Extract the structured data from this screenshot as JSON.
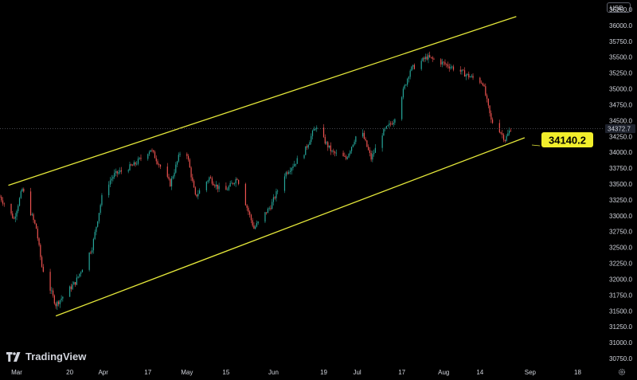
{
  "currency_label": "USD",
  "brand": {
    "name": "TradingView",
    "icon": "tradingview-logo-icon"
  },
  "settings_icon": "gear-icon",
  "colors": {
    "up": "#26a69a",
    "down": "#ef5350",
    "channel": "#e5e83a",
    "label_bg": "#f1ee2b",
    "axis_text": "#d1d4dc"
  },
  "chart_data": {
    "type": "candlestick",
    "y_axis": {
      "range": [
        30650,
        36400
      ],
      "ticks": [
        "36250.0",
        "36000.0",
        "35750.0",
        "35500.0",
        "35250.0",
        "35000.0",
        "34750.0",
        "34500.0",
        "34250.0",
        "34000.0",
        "33750.0",
        "33500.0",
        "33250.0",
        "33000.0",
        "32750.0",
        "32500.0",
        "32250.0",
        "32000.0",
        "31750.0",
        "31500.0",
        "31250.0",
        "31000.0",
        "30750.0"
      ]
    },
    "x_axis": {
      "ticks": [
        {
          "label": "Mar",
          "date": "2023-03-01"
        },
        {
          "label": "20",
          "date": "2023-03-20"
        },
        {
          "label": "Apr",
          "date": "2023-04-01"
        },
        {
          "label": "17",
          "date": "2023-04-17"
        },
        {
          "label": "May",
          "date": "2023-05-01"
        },
        {
          "label": "15",
          "date": "2023-05-15"
        },
        {
          "label": "Jun",
          "date": "2023-06-01"
        },
        {
          "label": "19",
          "date": "2023-06-19"
        },
        {
          "label": "Jul",
          "date": "2023-07-01"
        },
        {
          "label": "17",
          "date": "2023-07-17"
        },
        {
          "label": "Aug",
          "date": "2023-08-01"
        },
        {
          "label": "14",
          "date": "2023-08-14"
        },
        {
          "label": "Sep",
          "date": "2023-09-01"
        },
        {
          "label": "18",
          "date": "2023-09-18"
        }
      ],
      "range": [
        "2023-02-23",
        "2023-09-27"
      ]
    },
    "channel_lines": [
      {
        "name": "upper",
        "start": {
          "date": "2023-02-26",
          "value": 33480
        },
        "end": {
          "date": "2023-08-27",
          "value": 36140
        }
      },
      {
        "name": "lower",
        "start": {
          "date": "2023-03-15",
          "value": 31420
        },
        "end": {
          "date": "2023-08-30",
          "value": 34230
        }
      }
    ],
    "key_prices": [
      {
        "date": "2023-02-23",
        "value": 33300
      },
      {
        "date": "2023-02-28",
        "value": 32950
      },
      {
        "date": "2023-03-03",
        "value": 33420
      },
      {
        "date": "2023-03-08",
        "value": 32800
      },
      {
        "date": "2023-03-10",
        "value": 32200
      },
      {
        "date": "2023-03-15",
        "value": 31600
      },
      {
        "date": "2023-03-22",
        "value": 31950
      },
      {
        "date": "2023-03-28",
        "value": 32500
      },
      {
        "date": "2023-04-01",
        "value": 33400
      },
      {
        "date": "2023-04-05",
        "value": 33650
      },
      {
        "date": "2023-04-12",
        "value": 33800
      },
      {
        "date": "2023-04-18",
        "value": 34050
      },
      {
        "date": "2023-04-25",
        "value": 33500
      },
      {
        "date": "2023-04-30",
        "value": 34200
      },
      {
        "date": "2023-05-04",
        "value": 33300
      },
      {
        "date": "2023-05-09",
        "value": 33600
      },
      {
        "date": "2023-05-14",
        "value": 33350
      },
      {
        "date": "2023-05-19",
        "value": 33600
      },
      {
        "date": "2023-05-25",
        "value": 32800
      },
      {
        "date": "2023-05-31",
        "value": 33150
      },
      {
        "date": "2023-06-05",
        "value": 33650
      },
      {
        "date": "2023-06-12",
        "value": 34000
      },
      {
        "date": "2023-06-16",
        "value": 34400
      },
      {
        "date": "2023-06-22",
        "value": 34000
      },
      {
        "date": "2023-06-27",
        "value": 33900
      },
      {
        "date": "2023-07-02",
        "value": 34400
      },
      {
        "date": "2023-07-06",
        "value": 33900
      },
      {
        "date": "2023-07-10",
        "value": 34300
      },
      {
        "date": "2023-07-14",
        "value": 34500
      },
      {
        "date": "2023-07-20",
        "value": 35300
      },
      {
        "date": "2023-07-26",
        "value": 35500
      },
      {
        "date": "2023-08-01",
        "value": 35400
      },
      {
        "date": "2023-08-06",
        "value": 35300
      },
      {
        "date": "2023-08-10",
        "value": 35200
      },
      {
        "date": "2023-08-15",
        "value": 35100
      },
      {
        "date": "2023-08-18",
        "value": 34500
      },
      {
        "date": "2023-08-21",
        "value": 34350
      },
      {
        "date": "2023-08-23",
        "value": 34200
      },
      {
        "date": "2023-08-25",
        "value": 34372.7
      }
    ],
    "current_price": {
      "value": "34372.7",
      "num": 34372.7
    },
    "annotation": {
      "text": "34140.2",
      "value": 34140.2
    }
  }
}
